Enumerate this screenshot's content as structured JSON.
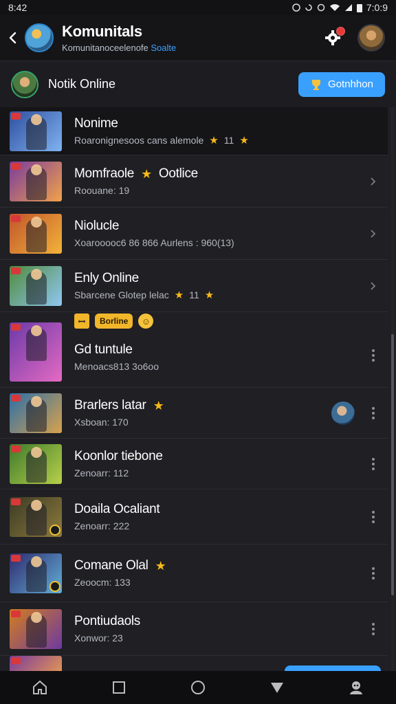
{
  "statusbar": {
    "time": "8:42",
    "battery_time": "7:0:9"
  },
  "appbar": {
    "title": "Komunitals",
    "subtitle_prefix": "Komunitanoceelenofe ",
    "subtitle_accent": "Soalte"
  },
  "online": {
    "label": "Notik Online",
    "button_label": "Gotnhhon"
  },
  "rows": [
    {
      "name": "Nonime",
      "sub": "Roaronignesoos cans alemole",
      "count": "11",
      "star_in_name": false,
      "star_sub": true,
      "trail": "none",
      "highlight": true,
      "colors": [
        "#2f4f9f",
        "#7fb3f0"
      ]
    },
    {
      "name": "Momfraole",
      "name_extra": "Ootlice",
      "sub": "Roouane: 19",
      "star_in_name": true,
      "trail": "chevron",
      "colors": [
        "#7a3b9d",
        "#f1a24a"
      ]
    },
    {
      "name": "Niolucle",
      "sub": "Xoarooooc6 86 866 Aurlens : 960(13)",
      "star_in_name": false,
      "trail": "chevron",
      "colors": [
        "#c0552b",
        "#f3b33a"
      ]
    },
    {
      "name": "Enly Online",
      "sub": "Sbarcene Glotep lelac",
      "count": "11",
      "star_in_name": false,
      "star_sub": true,
      "trail": "chevron",
      "colors": [
        "#4f8b3c",
        "#8fc7f2"
      ]
    },
    {
      "name": "Gd tuntule",
      "sub": "Menoacs813 3o6oo",
      "chips": {
        "chip_label": "Borline"
      },
      "trail": "dots",
      "tall": true,
      "colors": [
        "#6b3aa8",
        "#e46ac3"
      ]
    },
    {
      "name": "Brarlers latar",
      "sub": "Xsboan: 170",
      "star_in_name": true,
      "trail": "dots",
      "avatar": true,
      "colors": [
        "#2c6fa8",
        "#d8a24d"
      ]
    },
    {
      "name": "Koonlor tiebone",
      "sub": "Zenoarr: 112",
      "star_in_name": false,
      "trail": "dots",
      "colors": [
        "#3f7a2c",
        "#b7d04a"
      ]
    },
    {
      "name": "Doaila Ocaliant",
      "sub": "Zenoarr: 222",
      "star_in_name": false,
      "trail": "dots",
      "badge": true,
      "colors": [
        "#3b3a25",
        "#8d7b3c"
      ]
    },
    {
      "name": "Comane Olal",
      "sub": "Zeoocm: 133",
      "star_in_name": true,
      "trail": "dots",
      "badge": true,
      "colors": [
        "#2f2a6e",
        "#62b0d8"
      ]
    },
    {
      "name": "Pontiudaols",
      "sub": "Xonwor: 23",
      "star_in_name": false,
      "trail": "dots",
      "colors": [
        "#d37d1e",
        "#6e3aa0"
      ]
    }
  ],
  "icons": {
    "back": "arrow-left-icon",
    "settings": "gear-icon",
    "nav": [
      "home-icon",
      "square-icon",
      "circle-icon",
      "triangle-down-icon",
      "profile-icon"
    ]
  },
  "colors": {
    "accent": "#3aa0ff",
    "star": "#f5b919",
    "notification": "#e33b3b"
  }
}
